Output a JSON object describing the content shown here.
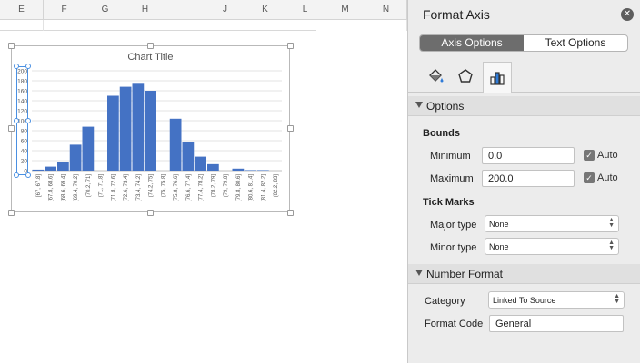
{
  "sheet": {
    "columns": [
      "E",
      "F",
      "G",
      "H",
      "I",
      "J",
      "K",
      "L",
      "M",
      "N"
    ]
  },
  "chart_data": {
    "type": "bar",
    "title": "Chart Title",
    "categories": [
      "[67, 67.8]",
      "(67.8, 68.6]",
      "(68.6, 69.4]",
      "(69.4, 70.2]",
      "(70.2, 71]",
      "(71, 71.8]",
      "(71.8, 72.6]",
      "(72.6, 73.4]",
      "(73.4, 74.2]",
      "(74.2, 75]",
      "(75, 75.8]",
      "(75.8, 76.6]",
      "(76.6, 77.4]",
      "(77.4, 78.2]",
      "(78.2, 79]",
      "(79, 79.8]",
      "(79.8, 80.6]",
      "(80.6, 81.4]",
      "(81.4, 82.2]",
      "(82.2, 83]"
    ],
    "values": [
      2,
      8,
      18,
      52,
      88,
      0,
      150,
      168,
      174,
      160,
      0,
      104,
      58,
      28,
      13,
      0,
      4,
      1,
      1,
      0
    ],
    "ylim": [
      0,
      200
    ],
    "yticks": [
      "200",
      "180",
      "160",
      "140",
      "120",
      "100",
      "80",
      "60",
      "40",
      "20",
      "0"
    ],
    "color": "#4472c4",
    "grid": true
  },
  "pane": {
    "title": "Format Axis",
    "tabs": [
      "Axis Options",
      "Text Options"
    ],
    "icons": [
      "fill-line-icon",
      "effects-pentagon-icon",
      "axis-options-bars-icon"
    ],
    "options": {
      "header": "Options",
      "bounds_label": "Bounds",
      "minimum_label": "Minimum",
      "minimum_value": "0.0",
      "maximum_label": "Maximum",
      "maximum_value": "200.0",
      "auto_label": "Auto",
      "tick_marks_label": "Tick Marks",
      "major_label": "Major type",
      "major_value": "None",
      "minor_label": "Minor type",
      "minor_value": "None"
    },
    "number_format": {
      "header": "Number Format",
      "category_label": "Category",
      "category_value": "Linked To Source",
      "format_code_label": "Format Code",
      "format_code_value": "General"
    }
  }
}
